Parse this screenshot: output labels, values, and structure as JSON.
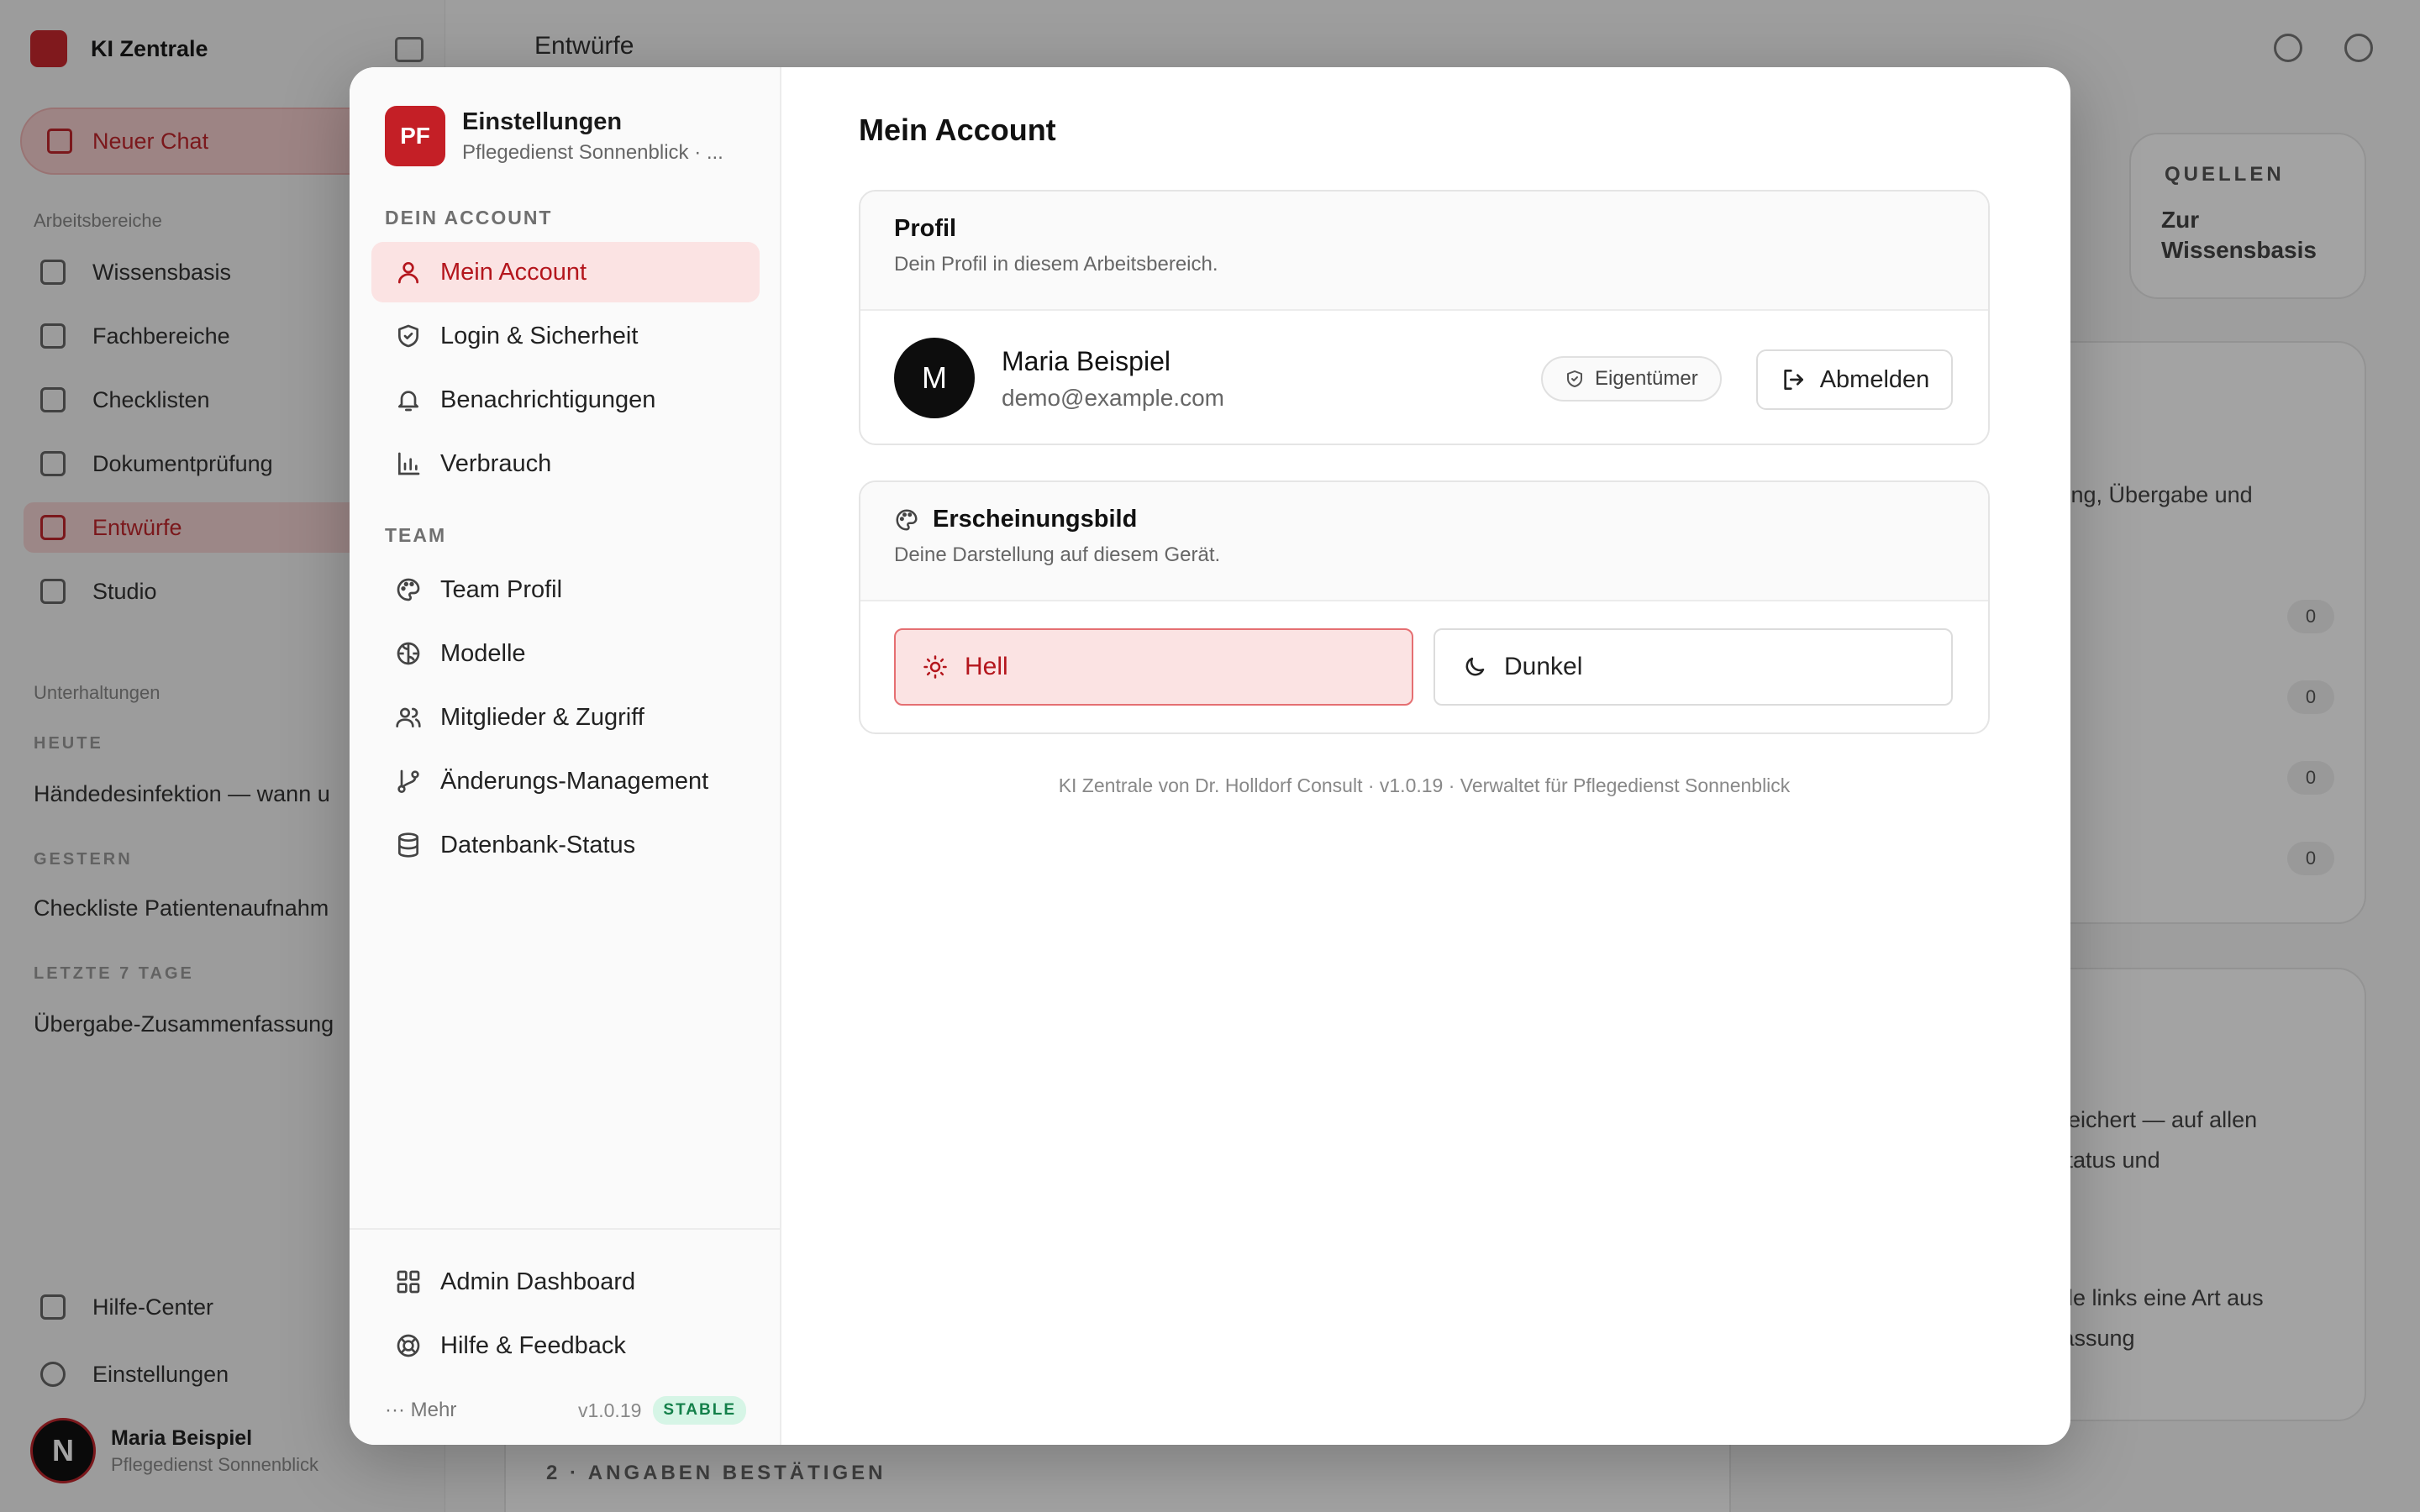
{
  "background": {
    "brand": "KI Zentrale",
    "new_chat": "Neuer Chat",
    "section_workspaces": "Arbeitsbereiche",
    "nav": [
      "Wissensbasis",
      "Fachbereiche",
      "Checklisten",
      "Dokumentprüfung",
      "Entwürfe",
      "Studio"
    ],
    "section_conversations": "Unterhaltungen",
    "group_today": "HEUTE",
    "conv_today": "Händedesinfektion — wann u",
    "group_yesterday": "GESTERN",
    "conv_yesterday": "Checkliste Patientenaufnahm",
    "group_last7": "LETZTE 7 TAGE",
    "conv_last7": "Übergabe-Zusammenfassung",
    "help_center": "Hilfe-Center",
    "settings": "Einstellungen",
    "user_name": "Maria Beispiel",
    "user_sub": "Pflegedienst Sonnenblick",
    "user_initial": "N",
    "top_title": "Entwürfe",
    "sources_label": "QUELLEN",
    "sources_link": "Zur Wissensbasis",
    "text_a": "fung, Übergabe und",
    "badge_value": "0",
    "text_b": "peichert — auf allen",
    "text_c": "status und",
    "text_d": "hle links eine Art aus",
    "text_e": "fassung",
    "bottom_label": "2 · ANGABEN BESTÄTIGEN"
  },
  "settings_sidebar": {
    "logo": "PF",
    "title": "Einstellungen",
    "subtitle": "Pflegedienst Sonnenblick · ...",
    "section_account": "DEIN ACCOUNT",
    "account_items": [
      {
        "label": "Mein Account",
        "icon": "user-icon"
      },
      {
        "label": "Login & Sicherheit",
        "icon": "shield-icon"
      },
      {
        "label": "Benachrichtigungen",
        "icon": "bell-icon"
      },
      {
        "label": "Verbrauch",
        "icon": "bar-chart-icon"
      }
    ],
    "section_team": "TEAM",
    "team_items": [
      {
        "label": "Team Profil",
        "icon": "palette-icon"
      },
      {
        "label": "Modelle",
        "icon": "brain-icon"
      },
      {
        "label": "Mitglieder & Zugriff",
        "icon": "users-icon"
      },
      {
        "label": "Änderungs-Management",
        "icon": "git-branch-icon"
      },
      {
        "label": "Datenbank-Status",
        "icon": "database-icon"
      }
    ],
    "bottom_items": [
      {
        "label": "Admin Dashboard",
        "icon": "grid-icon"
      },
      {
        "label": "Hilfe & Feedback",
        "icon": "lifebuoy-icon"
      }
    ],
    "more": "··· Mehr",
    "version": "v1.0.19",
    "channel": "STABLE"
  },
  "main": {
    "title": "Mein Account",
    "profile": {
      "title": "Profil",
      "description": "Dein Profil in diesem Arbeitsbereich.",
      "avatar_initial": "M",
      "name": "Maria Beispiel",
      "email": "demo@example.com",
      "role": "Eigentümer",
      "logout": "Abmelden"
    },
    "appearance": {
      "title": "Erscheinungsbild",
      "description": "Deine Darstellung auf diesem Gerät.",
      "light": "Hell",
      "dark": "Dunkel",
      "selected": "Hell"
    },
    "footer": "KI Zentrale von Dr. Holldorf Consult · v1.0.19 · Verwaltet für Pflegedienst Sonnenblick"
  },
  "colors": {
    "accent": "#c41f26",
    "accent_bg": "#fbe3e3",
    "stable_bg": "#d6f5e6",
    "stable_fg": "#14804a"
  }
}
